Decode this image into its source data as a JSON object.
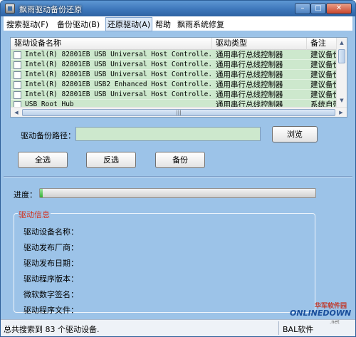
{
  "window": {
    "title": "飘雨驱动备份还原"
  },
  "titlebar": {
    "min": "–",
    "max": "□",
    "close": "✕"
  },
  "menu": [
    {
      "label": "搜索驱动(F)"
    },
    {
      "label": "备份驱动(B)"
    },
    {
      "label": "还原驱动(A)"
    },
    {
      "label": "帮助"
    },
    {
      "label": "飘雨系统修复"
    }
  ],
  "driver_list": {
    "columns": [
      "驱动设备名称",
      "驱动类型",
      "备注"
    ],
    "rows": [
      {
        "name": "Intel(R) 82801EB USB Universal Host Controlle...",
        "type": "通用串行总线控制器",
        "note": "建议备份"
      },
      {
        "name": "Intel(R) 82801EB USB Universal Host Controlle...",
        "type": "通用串行总线控制器",
        "note": "建议备份"
      },
      {
        "name": "Intel(R) 82801EB USB Universal Host Controlle...",
        "type": "通用串行总线控制器",
        "note": "建议备份"
      },
      {
        "name": "Intel(R) 82801EB USB2 Enhanced Host Controlle...",
        "type": "通用串行总线控制器",
        "note": "建议备份"
      },
      {
        "name": "Intel(R) 82801EB USB Universal Host Controlle...",
        "type": "通用串行总线控制器",
        "note": "建议备份"
      },
      {
        "name": "USB Root Hub",
        "type": "通用串行总线控制器",
        "note": "系统自带"
      }
    ],
    "scroll_thumb_glyph": "|||"
  },
  "path": {
    "label": "驱动备份路径：",
    "value": "",
    "browse_label": "浏览"
  },
  "actions": {
    "select_all": "全选",
    "invert": "反选",
    "backup": "备份"
  },
  "progress": {
    "label": "进度：",
    "value": 0.01
  },
  "driver_info": {
    "title": "驱动信息",
    "fields": [
      "驱动设备名称：",
      "驱动发布厂商：",
      "驱动发布日期：",
      "驱动程序版本：",
      "微软数字签名：",
      "驱动程序文件："
    ]
  },
  "status": {
    "text": "总共搜索到 83 个驱动设备.",
    "brand": "BAL软件"
  },
  "watermark": {
    "top": "华军软件园",
    "main": "ONLINEDOWN",
    "sub": ".net"
  }
}
